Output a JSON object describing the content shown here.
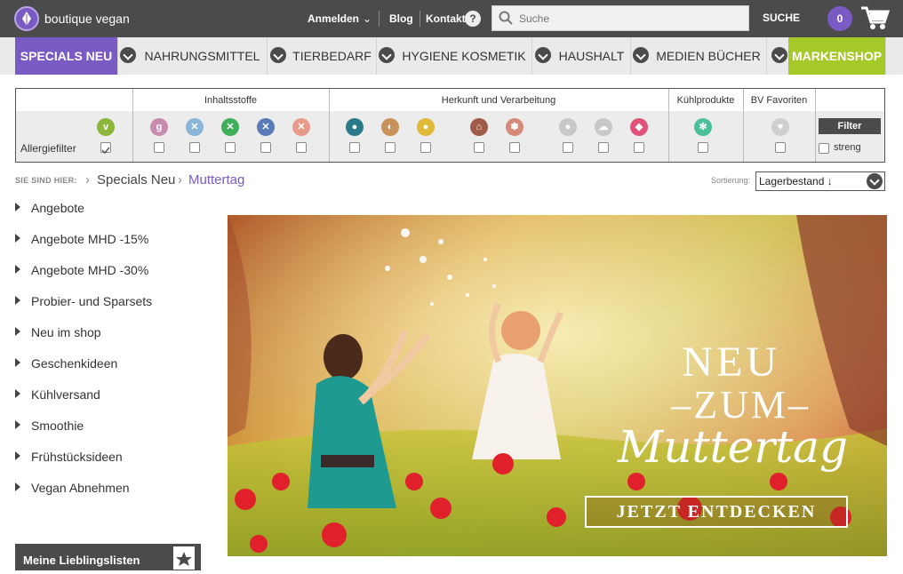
{
  "header": {
    "logo_text": "boutique vegan",
    "login": "Anmelden",
    "blog": "Blog",
    "kontakt": "Kontakt",
    "help": "?",
    "search_placeholder": "Suche",
    "search_button": "SUCHE",
    "cart_count": "0"
  },
  "nav": {
    "items": [
      {
        "label": "SPECIALS NEU",
        "active": true
      },
      {
        "label": "NAHRUNGSMITTEL"
      },
      {
        "label": "TIERBEDARF"
      },
      {
        "label": "HYGIENE KOSMETIK"
      },
      {
        "label": "HAUSHALT"
      },
      {
        "label": "MEDIEN BÜCHER"
      },
      {
        "label": "MARKENSHOP"
      }
    ],
    "active_color": "#7a5bc4",
    "markenshop_color": "#a6c92a"
  },
  "filter": {
    "allergie_label": "Allergiefilter",
    "headings": {
      "inhaltsstoffe": "Inhaltsstoffe",
      "herkunft": "Herkunft und Verarbeitung",
      "kuehl": "Kühlprodukte",
      "bv": "BV Favoriten"
    },
    "button": "Filter",
    "streng": "streng",
    "icons": [
      {
        "name": "vegan-icon",
        "color": "#8cb63c",
        "glyph": "v"
      },
      {
        "name": "gluten-free-icon",
        "color": "#c98ab0",
        "glyph": "g"
      },
      {
        "name": "soy-free-icon",
        "color": "#8ab4d8",
        "glyph": "✕"
      },
      {
        "name": "sugar-free-icon",
        "color": "#3fae5a",
        "glyph": "✕"
      },
      {
        "name": "nut-free-icon",
        "color": "#5a7ab8",
        "glyph": "✕"
      },
      {
        "name": "palm-oil-free-icon",
        "color": "#e89a8a",
        "glyph": "✕"
      },
      {
        "name": "water-drop-icon",
        "color": "#2a7a8a",
        "glyph": "●"
      },
      {
        "name": "leaf-icon",
        "color": "#c8925a",
        "glyph": "◐"
      },
      {
        "name": "fruit-icon",
        "color": "#e0b83a",
        "glyph": "●"
      },
      {
        "name": "house-icon",
        "color": "#a05a4a",
        "glyph": "⌂"
      },
      {
        "name": "recycle-icon",
        "color": "#d88a7a",
        "glyph": "✽"
      },
      {
        "name": "earth-icon",
        "color": "#c8c8c8",
        "glyph": "●"
      },
      {
        "name": "cloud-icon",
        "color": "#c8c8c8",
        "glyph": "☁"
      },
      {
        "name": "fish-icon",
        "color": "#e0527a",
        "glyph": "◆"
      },
      {
        "name": "snowflake-icon",
        "color": "#4ac09a",
        "glyph": "✻"
      },
      {
        "name": "heart-icon",
        "color": "#cfcfcf",
        "glyph": "♥"
      }
    ]
  },
  "breadcrumb": {
    "label": "SIE SIND HIER:",
    "level1": "Specials Neu",
    "level2": "Muttertag",
    "arrow": "›"
  },
  "sort": {
    "label": "Sortierung:",
    "value": "Lagerbestand ↓"
  },
  "sidebar": {
    "items": [
      "Angebote",
      "Angebote MHD -15%",
      "Angebote MHD -30%",
      "Probier- und Sparsets",
      "Neu im shop",
      "Geschenkideen",
      "Kühlversand",
      "Smoothie",
      "Frühstücksideen",
      "Vegan Abnehmen"
    ],
    "favorites": "Meine Lieblingslisten"
  },
  "banner": {
    "line1": "NEU",
    "line2": "–ZUM–",
    "line3": "Muttertag",
    "cta": "JETZT ENTDECKEN"
  }
}
